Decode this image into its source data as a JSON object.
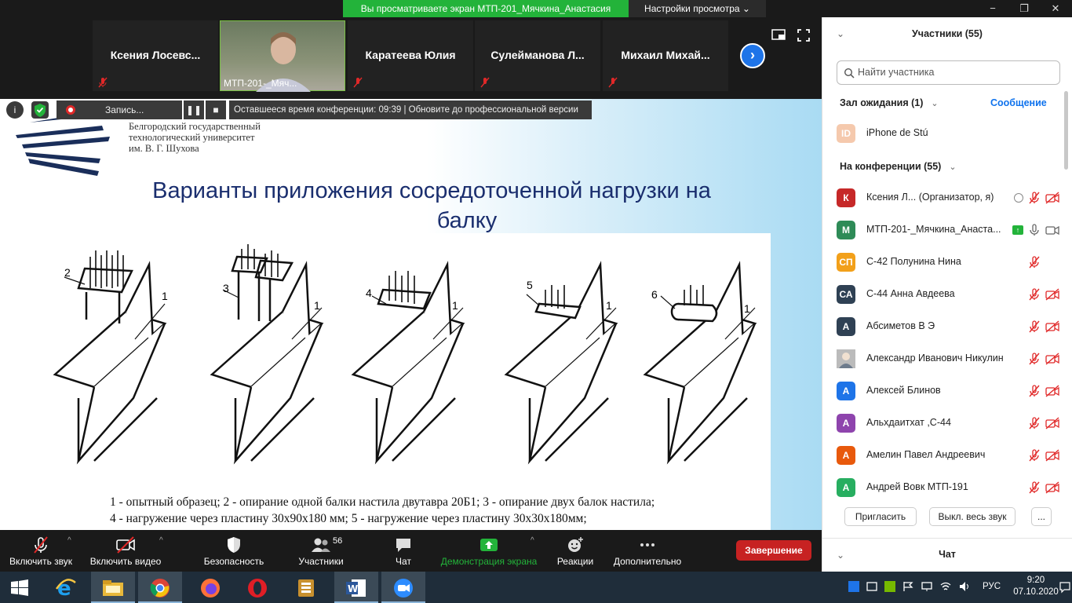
{
  "banner": {
    "sharing_text": "Вы  просматриваете  экран  МТП-201_Мячкина_Анастасия",
    "view_settings": "Настройки просмотра"
  },
  "thumbnails": [
    {
      "name": "Ксения  Лосевс..."
    },
    {
      "name": "МТП-201-_Мяч..."
    },
    {
      "name": "Каратеева Юлия"
    },
    {
      "name": "Сулейманова  Л..."
    },
    {
      "name": "Михаил  Михай..."
    }
  ],
  "recording": {
    "label": "Запись...",
    "time_left": "Оставшееся время конференции: 09:39 | Обновите до профессиональной версии"
  },
  "slide": {
    "university": [
      "Белгородский государственный",
      "технологический университет",
      "им. В. Г. Шухова"
    ],
    "title_line1": "Варианты приложения сосредоточенной нагрузки на",
    "title_line2": "балку",
    "labels": [
      "1",
      "2",
      "1",
      "3",
      "4",
      "1",
      "5",
      "1",
      "6",
      "1"
    ],
    "caption_line1": "1 - опытный образец; 2 - опирание одной балки настила двутавра 20Б1; 3 - опирание двух балок настила;",
    "caption_line2": "4 - нагружение через пластину 30х90х180 мм; 5 - нагружение через пластину 30х30х180мм;"
  },
  "toolbar": {
    "mute": "Включить звук",
    "video": "Включить видео",
    "security": "Безопасность",
    "participants": "Участники",
    "participants_count": "56",
    "chat": "Чат",
    "share": "Демонстрация экрана",
    "reactions": "Реакции",
    "more": "Дополнительно",
    "end": "Завершение"
  },
  "panel": {
    "title": "Участники (55)",
    "search_placeholder": "Найти участника",
    "waiting_header": "Зал ожидания (1)",
    "message_link": "Сообщение",
    "waiting": [
      {
        "initials": "ID",
        "name": "iPhone de Stú",
        "color": "#f5c9ad"
      }
    ],
    "in_meeting_header": "На конференции (55)",
    "participants": [
      {
        "initials": "К",
        "name": "Ксения Л...  (Организатор, я)",
        "color": "#c62828"
      },
      {
        "initials": "М",
        "name": "МТП-201-_Мячкина_Анаста...",
        "color": "#2e8b57"
      },
      {
        "initials": "СП",
        "name": "С-42 Полунина Нина",
        "color": "#f2a01a"
      },
      {
        "initials": "СА",
        "name": "С-44 Анна Авдеева",
        "color": "#2f4154"
      },
      {
        "initials": "А",
        "name": "Абсиметов В Э",
        "color": "#2f4154"
      },
      {
        "initials": "",
        "name": "Александр Иванович Никулин",
        "color": "#9a9a9a"
      },
      {
        "initials": "А",
        "name": "Алексей Блинов",
        "color": "#1e74e8"
      },
      {
        "initials": "А",
        "name": "Альхдаитхат ,С-44",
        "color": "#8e44ad"
      },
      {
        "initials": "А",
        "name": "Амелин Павел Андреевич",
        "color": "#e8590c"
      },
      {
        "initials": "А",
        "name": "Андрей Вовк МТП-191",
        "color": "#27ae60"
      }
    ],
    "invite": "Пригласить",
    "mute_all": "Выкл. весь звук",
    "more": "...",
    "chat_header": "Чат"
  },
  "taskbar": {
    "lang": "РУС",
    "time": "9:20",
    "date": "07.10.2020"
  },
  "colors": {
    "zoom_green": "#23b33a",
    "zoom_blue": "#0e72ed",
    "end_red": "#c72222",
    "slide_title": "#1a2e6e"
  }
}
